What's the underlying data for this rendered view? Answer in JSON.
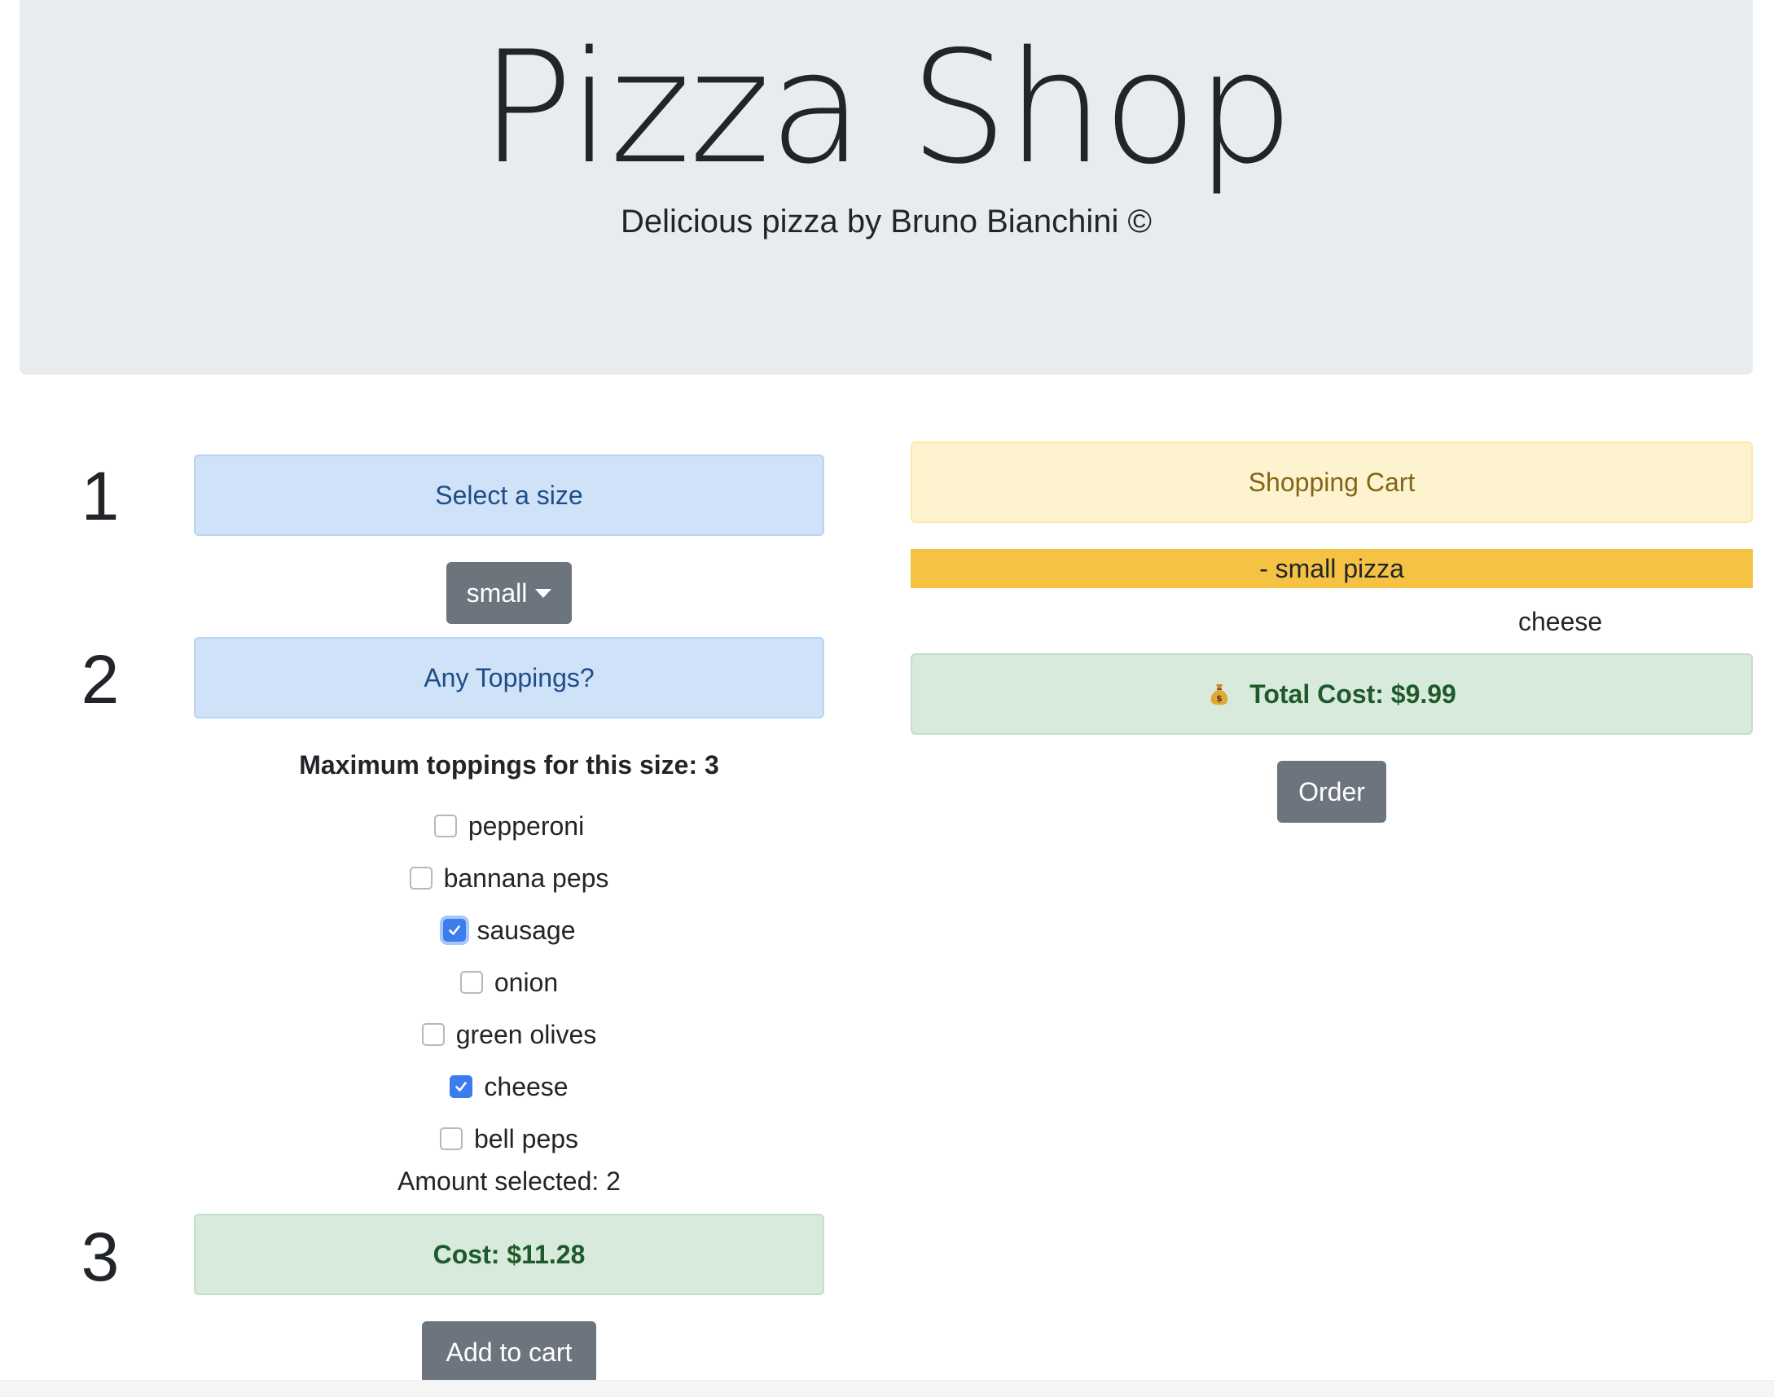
{
  "header": {
    "title": "Pizza Shop",
    "subtitle": "Delicious pizza by Bruno Bianchini ©"
  },
  "steps": [
    {
      "number": "1"
    },
    {
      "number": "2"
    },
    {
      "number": "3"
    }
  ],
  "size_section": {
    "heading": "Select a size",
    "dropdown": {
      "selected": "small",
      "icon": "caret-down-icon"
    }
  },
  "toppings_section": {
    "heading": "Any Toppings?",
    "max_label": "Maximum toppings for this size: 3",
    "options": [
      {
        "label": "pepperoni",
        "checked": false
      },
      {
        "label": "bannana peps",
        "checked": false
      },
      {
        "label": "sausage",
        "checked": true,
        "focused": true
      },
      {
        "label": "onion",
        "checked": false
      },
      {
        "label": "green olives",
        "checked": false
      },
      {
        "label": "cheese",
        "checked": true
      },
      {
        "label": "bell peps",
        "checked": false
      }
    ],
    "amount_selected": "Amount selected: 2"
  },
  "cost_section": {
    "cost_label": "Cost: $11.28",
    "add_to_cart_label": "Add to cart"
  },
  "cart": {
    "heading": "Shopping Cart",
    "items": [
      {
        "title": "- small pizza",
        "toppings": [
          "cheese"
        ]
      }
    ],
    "total_label": "Total Cost: $9.99",
    "total_icon": "money-bag-icon",
    "order_label": "Order"
  },
  "colors": {
    "jumbotron_bg": "#e9ecef",
    "primary_alert_bg": "#cfe2f8",
    "warning_alert_bg": "#fef3cf",
    "success_alert_bg": "#d8eadb",
    "cart_item_bg": "#f5c244",
    "secondary_button": "#6c757d",
    "checkbox_checked": "#3b7ded"
  }
}
